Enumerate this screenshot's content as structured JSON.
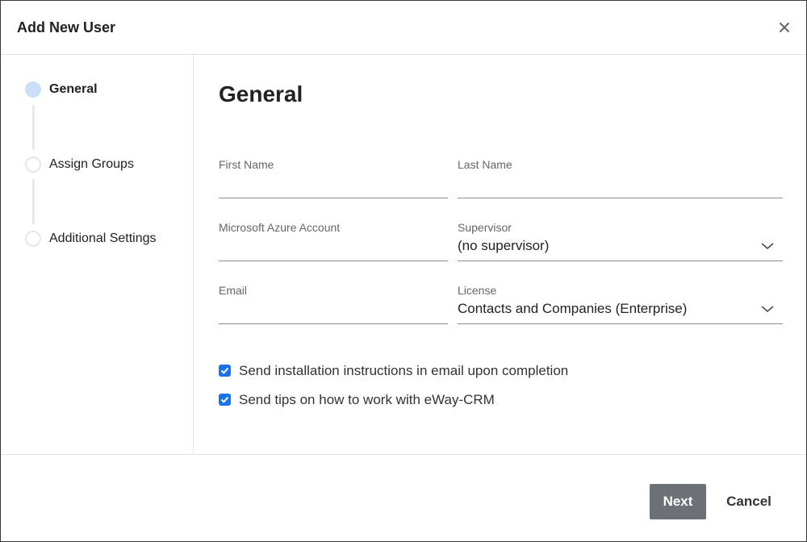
{
  "dialog": {
    "title": "Add New User",
    "close_icon": "close-icon"
  },
  "steps": [
    {
      "label": "General",
      "active": true
    },
    {
      "label": "Assign Groups",
      "active": false
    },
    {
      "label": "Additional Settings",
      "active": false
    }
  ],
  "main": {
    "heading": "General",
    "fields": {
      "first_name": {
        "label": "First Name",
        "value": ""
      },
      "last_name": {
        "label": "Last Name",
        "value": ""
      },
      "azure": {
        "label": "Microsoft Azure Account",
        "value": ""
      },
      "supervisor": {
        "label": "Supervisor",
        "value": "(no supervisor)",
        "icon": "chevron-down-icon"
      },
      "email": {
        "label": "Email",
        "value": ""
      },
      "license": {
        "label": "License",
        "value": "Contacts and Companies (Enterprise)",
        "icon": "chevron-down-icon"
      }
    },
    "checkboxes": [
      {
        "label": "Send installation instructions in email upon completion",
        "checked": true
      },
      {
        "label": "Send tips on how to work with eWay-CRM",
        "checked": true
      }
    ]
  },
  "footer": {
    "next_label": "Next",
    "cancel_label": "Cancel"
  },
  "colors": {
    "accent": "#1a73e8",
    "active_step": "#c9e0f6",
    "next_button": "#6b7177"
  }
}
